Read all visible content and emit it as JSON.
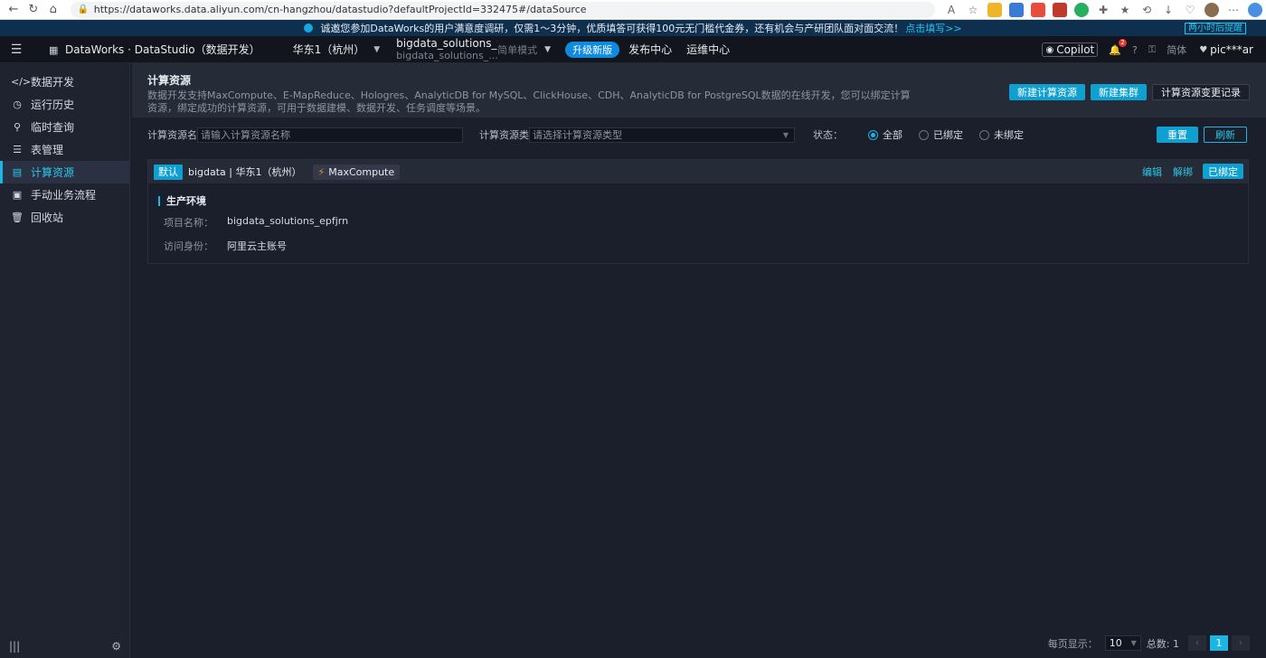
{
  "browser": {
    "url": "https://dataworks.data.aliyun.com/cn-hangzhou/datastudio?defaultProjectId=332475#/dataSource"
  },
  "announcement": {
    "text": "诚邀您参加DataWorks的用户满意度调研，仅需1～3分钟，优质填答可获得100元无门槛代金券，还有机会与产研团队面对面交流！",
    "link": "点击填写>>",
    "later": "两小时后提醒"
  },
  "header": {
    "brand": "DataWorks · DataStudio（数据开发）",
    "region": "华东1（杭州）",
    "project_main": "bigdata_solutions_to",
    "project_sub": "bigdata_solutions_...",
    "mode": "简单模式",
    "upgrade": "升级新版",
    "links": [
      "发布中心",
      "运维中心"
    ],
    "copilot": "Copilot",
    "notify_count": "2",
    "lang": "简体",
    "user": "pic***ar"
  },
  "sidebar": {
    "items": [
      {
        "label": "数据开发",
        "icon": "code-icon"
      },
      {
        "label": "运行历史",
        "icon": "history-icon"
      },
      {
        "label": "临时查询",
        "icon": "search-icon"
      },
      {
        "label": "表管理",
        "icon": "table-icon"
      },
      {
        "label": "计算资源",
        "icon": "database-icon",
        "active": true
      },
      {
        "label": "手动业务流程",
        "icon": "briefcase-icon"
      },
      {
        "label": "回收站",
        "icon": "trash-icon"
      }
    ]
  },
  "page": {
    "title": "计算资源",
    "description": "数据开发支持MaxCompute、E-MapReduce、Hologres、AnalyticDB for MySQL、ClickHouse、CDH、AnalyticDB for PostgreSQL数据的在线开发，您可以绑定计算资源，绑定成功的计算资源，可用于数据建模、数据开发、任务调度等场景。",
    "buttons": {
      "new_resource": "新建计算资源",
      "new_cluster": "新建集群",
      "change_log": "计算资源变更记录"
    }
  },
  "filters": {
    "name_label": "计算资源名",
    "name_placeholder": "请输入计算资源名称",
    "type_label": "计算资源类",
    "type_placeholder": "请选择计算资源类型",
    "status_label": "状态：",
    "status_options": [
      "全部",
      "已绑定",
      "未绑定"
    ],
    "status_selected": "全部",
    "reset": "重置",
    "refresh": "刷新"
  },
  "resource_card": {
    "tag": "默认",
    "name": "bigdata | 华东1（杭州）",
    "engine": "MaxCompute",
    "actions": {
      "edit": "编辑",
      "unbind": "解绑",
      "bound": "已绑定"
    },
    "env_title": "生产环境",
    "fields": [
      {
        "key": "项目名称：",
        "value": "bigdata_solutions_epfjrn"
      },
      {
        "key": "访问身份：",
        "value": "阿里云主账号"
      }
    ]
  },
  "pagination": {
    "per_page_label": "每页显示：",
    "per_page": "10",
    "total": "总数: 1",
    "current_page": "1"
  },
  "colors": {
    "accent": "#19b6e6",
    "primary_button": "#0fa0cf",
    "background": "#1b1f2b",
    "sidebar": "#1f2330"
  }
}
